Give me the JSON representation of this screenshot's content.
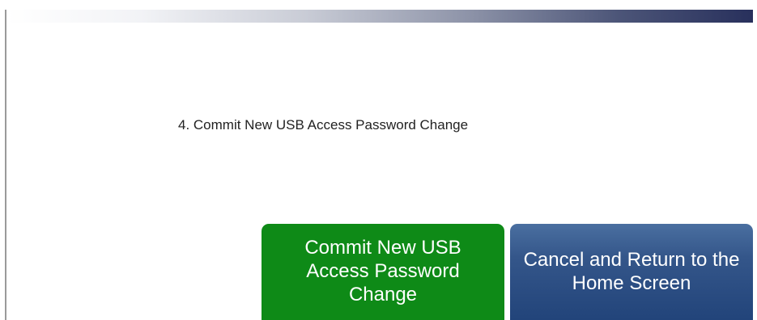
{
  "instruction": {
    "text": "4. Commit New USB Access Password Change"
  },
  "buttons": {
    "commit_label": "Commit New USB Access Password Change",
    "cancel_label": "Cancel and Return to the Home Screen"
  },
  "colors": {
    "commit_button": "#0e8a17",
    "cancel_button": "#34568a",
    "header_accent": "#28305c"
  }
}
